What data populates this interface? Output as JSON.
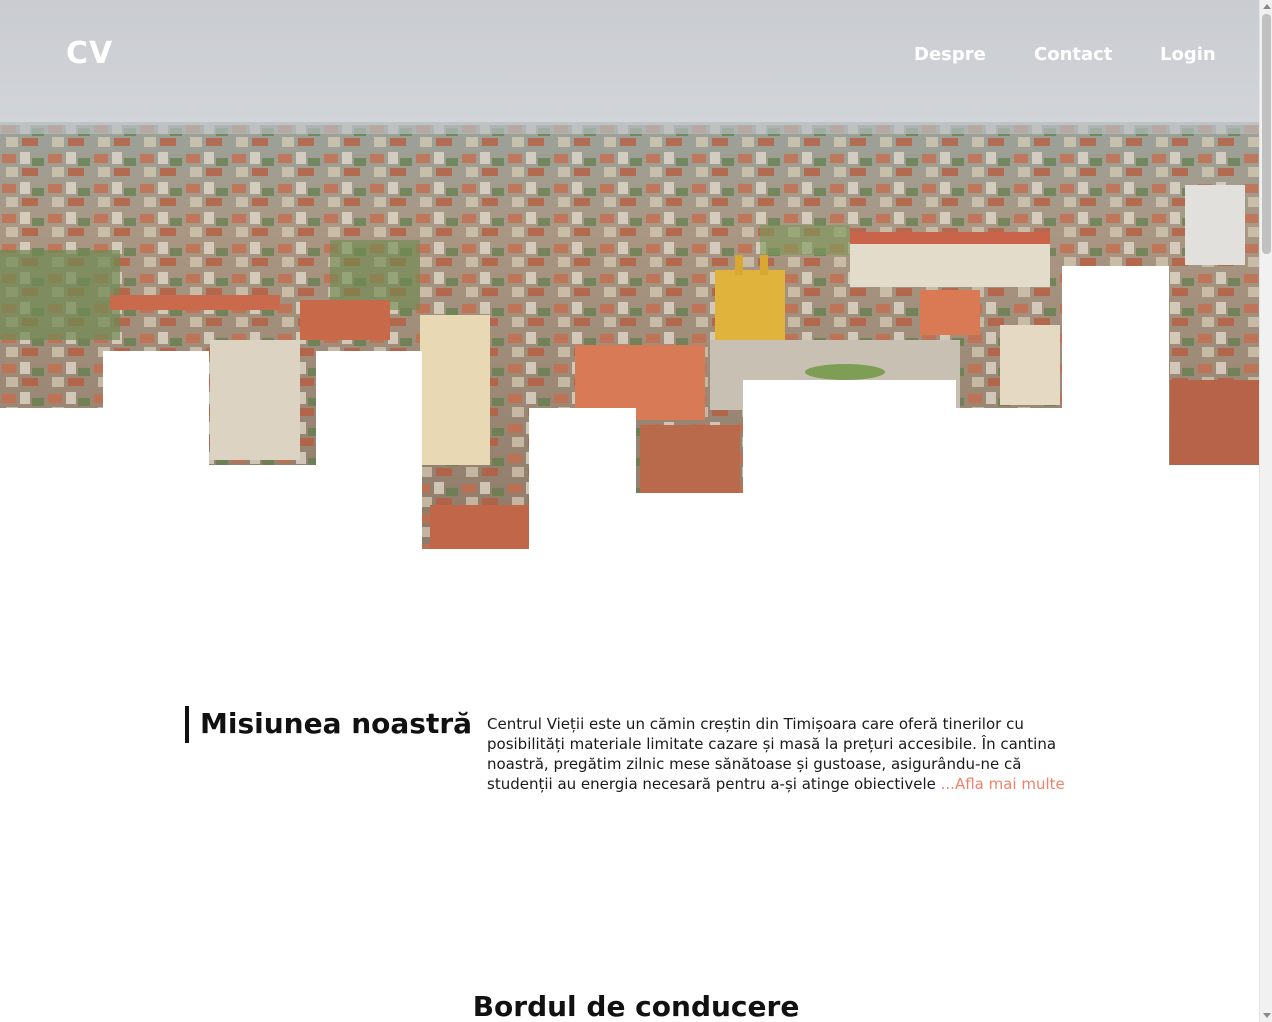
{
  "nav": {
    "logo": "CV",
    "links": [
      "Despre",
      "Contact",
      "Login"
    ]
  },
  "hero": {
    "image_subject": "aerial city view"
  },
  "mission": {
    "title": "Misiunea noastră",
    "text": "Centrul Vieții este un cămin creștin din Timișoara care oferă tinerilor cu posibilități materiale limitate cazare și masă la prețuri accesibile. În cantina noastră, pregătim zilnic mese sănătoase și gustoase, asigurându-ne că studenții au energia necesară pentru a-și atinge obiectivele",
    "read_more": " ...Afla mai multe"
  },
  "board": {
    "title": "Bordul de conducere"
  },
  "colors": {
    "accent": "#f0826a",
    "text": "#111111",
    "background": "#ffffff"
  }
}
